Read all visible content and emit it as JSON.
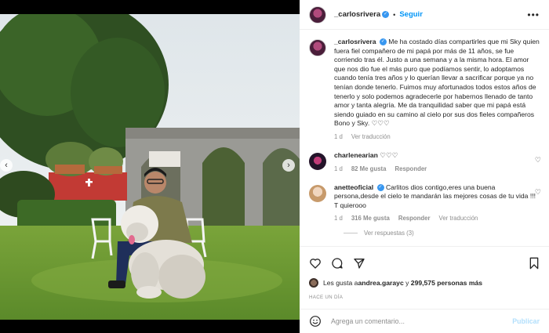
{
  "post": {
    "username": "_carlosrivera",
    "follow_label": "Seguir",
    "more_label": "•••",
    "caption": "Me ha costado días compartirles que mi Sky quien fuera fiel compañero de mi papá por más de 11 años, se fue corriendo tras él. Justo a una semana y a la misma hora. El amor que nos dio fue el más puro que podíamos sentir, lo adoptamos cuando tenía tres años y lo querían llevar a sacrificar porque ya no tenían donde tenerlo. Fuimos muy afortunados todos estos años de tenerlo y solo podemos agradecerle por habernos llenado de tanto amor y tanta alegría. Me da tranquilidad saber que mi papá está siendo guiado en su camino al cielo por sus dos fieles compañeros Bono y Sky. ♡♡♡",
    "caption_time": "1 d",
    "see_translation": "Ver traducción"
  },
  "comments": [
    {
      "username": "charlenearian",
      "text": "♡♡♡",
      "time": "1 d",
      "likes": "82 Me gusta",
      "reply": "Responder"
    },
    {
      "username": "anetteoficial",
      "text": "Carlitos dios contigo,eres una buena persona,desde el cielo te mandarán las mejores cosas de tu vida !!! T quierooo",
      "time": "1 d",
      "likes": "316 Me gusta",
      "reply": "Responder",
      "see_translation": "Ver traducción",
      "view_replies": "Ver respuestas (3)"
    }
  ],
  "likes_summary": {
    "prefix": "Les gusta a ",
    "user": "andrea.garayc",
    "middle": " y ",
    "count": "299,575 personas más"
  },
  "timestamp": "HACE UN DÍA",
  "add_comment": {
    "placeholder": "Agrega un comentario...",
    "post_label": "Publicar"
  },
  "icons": [
    "heart-icon",
    "comment-icon",
    "share-icon",
    "bookmark-icon",
    "emoji-icon",
    "verified-icon"
  ],
  "colors": {
    "accent": "#0095f6",
    "verified": "#3897f0",
    "muted": "#8e8e8e",
    "post_disabled": "#b2dffc"
  }
}
